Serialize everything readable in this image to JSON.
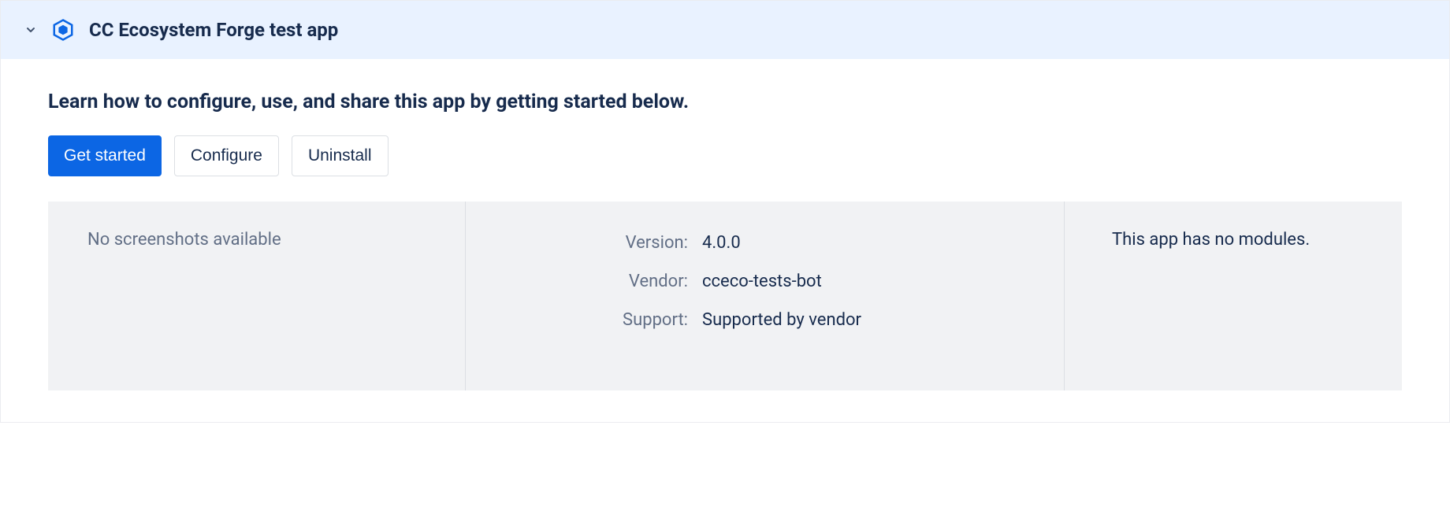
{
  "header": {
    "app_name": "CC Ecosystem Forge test app"
  },
  "intro_text": "Learn how to configure, use, and share this app by getting started below.",
  "buttons": {
    "get_started": "Get started",
    "configure": "Configure",
    "uninstall": "Uninstall"
  },
  "panel": {
    "screenshots_empty": "No screenshots available",
    "details": {
      "version_label": "Version:",
      "version_value": "4.0.0",
      "vendor_label": "Vendor:",
      "vendor_value": "cceco-tests-bot",
      "support_label": "Support:",
      "support_value": "Supported by vendor"
    },
    "modules_empty": "This app has no modules."
  }
}
